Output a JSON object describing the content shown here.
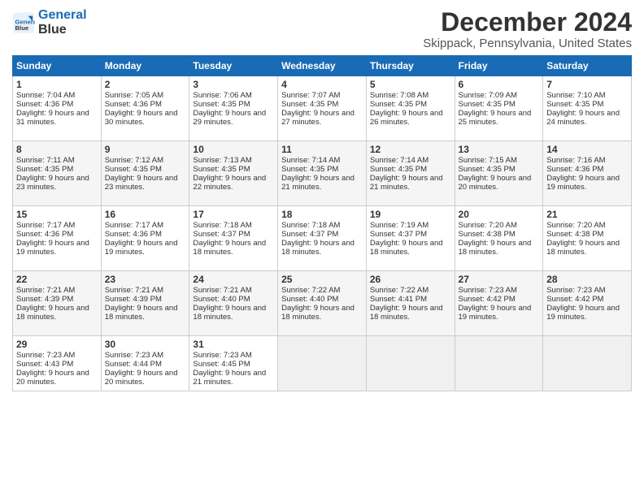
{
  "logo": {
    "line1": "General",
    "line2": "Blue"
  },
  "title": "December 2024",
  "subtitle": "Skippack, Pennsylvania, United States",
  "days": [
    "Sunday",
    "Monday",
    "Tuesday",
    "Wednesday",
    "Thursday",
    "Friday",
    "Saturday"
  ],
  "weeks": [
    [
      {
        "num": "1",
        "sunrise": "Sunrise: 7:04 AM",
        "sunset": "Sunset: 4:36 PM",
        "daylight": "Daylight: 9 hours and 31 minutes."
      },
      {
        "num": "2",
        "sunrise": "Sunrise: 7:05 AM",
        "sunset": "Sunset: 4:36 PM",
        "daylight": "Daylight: 9 hours and 30 minutes."
      },
      {
        "num": "3",
        "sunrise": "Sunrise: 7:06 AM",
        "sunset": "Sunset: 4:35 PM",
        "daylight": "Daylight: 9 hours and 29 minutes."
      },
      {
        "num": "4",
        "sunrise": "Sunrise: 7:07 AM",
        "sunset": "Sunset: 4:35 PM",
        "daylight": "Daylight: 9 hours and 27 minutes."
      },
      {
        "num": "5",
        "sunrise": "Sunrise: 7:08 AM",
        "sunset": "Sunset: 4:35 PM",
        "daylight": "Daylight: 9 hours and 26 minutes."
      },
      {
        "num": "6",
        "sunrise": "Sunrise: 7:09 AM",
        "sunset": "Sunset: 4:35 PM",
        "daylight": "Daylight: 9 hours and 25 minutes."
      },
      {
        "num": "7",
        "sunrise": "Sunrise: 7:10 AM",
        "sunset": "Sunset: 4:35 PM",
        "daylight": "Daylight: 9 hours and 24 minutes."
      }
    ],
    [
      {
        "num": "8",
        "sunrise": "Sunrise: 7:11 AM",
        "sunset": "Sunset: 4:35 PM",
        "daylight": "Daylight: 9 hours and 23 minutes."
      },
      {
        "num": "9",
        "sunrise": "Sunrise: 7:12 AM",
        "sunset": "Sunset: 4:35 PM",
        "daylight": "Daylight: 9 hours and 23 minutes."
      },
      {
        "num": "10",
        "sunrise": "Sunrise: 7:13 AM",
        "sunset": "Sunset: 4:35 PM",
        "daylight": "Daylight: 9 hours and 22 minutes."
      },
      {
        "num": "11",
        "sunrise": "Sunrise: 7:14 AM",
        "sunset": "Sunset: 4:35 PM",
        "daylight": "Daylight: 9 hours and 21 minutes."
      },
      {
        "num": "12",
        "sunrise": "Sunrise: 7:14 AM",
        "sunset": "Sunset: 4:35 PM",
        "daylight": "Daylight: 9 hours and 21 minutes."
      },
      {
        "num": "13",
        "sunrise": "Sunrise: 7:15 AM",
        "sunset": "Sunset: 4:35 PM",
        "daylight": "Daylight: 9 hours and 20 minutes."
      },
      {
        "num": "14",
        "sunrise": "Sunrise: 7:16 AM",
        "sunset": "Sunset: 4:36 PM",
        "daylight": "Daylight: 9 hours and 19 minutes."
      }
    ],
    [
      {
        "num": "15",
        "sunrise": "Sunrise: 7:17 AM",
        "sunset": "Sunset: 4:36 PM",
        "daylight": "Daylight: 9 hours and 19 minutes."
      },
      {
        "num": "16",
        "sunrise": "Sunrise: 7:17 AM",
        "sunset": "Sunset: 4:36 PM",
        "daylight": "Daylight: 9 hours and 19 minutes."
      },
      {
        "num": "17",
        "sunrise": "Sunrise: 7:18 AM",
        "sunset": "Sunset: 4:37 PM",
        "daylight": "Daylight: 9 hours and 18 minutes."
      },
      {
        "num": "18",
        "sunrise": "Sunrise: 7:18 AM",
        "sunset": "Sunset: 4:37 PM",
        "daylight": "Daylight: 9 hours and 18 minutes."
      },
      {
        "num": "19",
        "sunrise": "Sunrise: 7:19 AM",
        "sunset": "Sunset: 4:37 PM",
        "daylight": "Daylight: 9 hours and 18 minutes."
      },
      {
        "num": "20",
        "sunrise": "Sunrise: 7:20 AM",
        "sunset": "Sunset: 4:38 PM",
        "daylight": "Daylight: 9 hours and 18 minutes."
      },
      {
        "num": "21",
        "sunrise": "Sunrise: 7:20 AM",
        "sunset": "Sunset: 4:38 PM",
        "daylight": "Daylight: 9 hours and 18 minutes."
      }
    ],
    [
      {
        "num": "22",
        "sunrise": "Sunrise: 7:21 AM",
        "sunset": "Sunset: 4:39 PM",
        "daylight": "Daylight: 9 hours and 18 minutes."
      },
      {
        "num": "23",
        "sunrise": "Sunrise: 7:21 AM",
        "sunset": "Sunset: 4:39 PM",
        "daylight": "Daylight: 9 hours and 18 minutes."
      },
      {
        "num": "24",
        "sunrise": "Sunrise: 7:21 AM",
        "sunset": "Sunset: 4:40 PM",
        "daylight": "Daylight: 9 hours and 18 minutes."
      },
      {
        "num": "25",
        "sunrise": "Sunrise: 7:22 AM",
        "sunset": "Sunset: 4:40 PM",
        "daylight": "Daylight: 9 hours and 18 minutes."
      },
      {
        "num": "26",
        "sunrise": "Sunrise: 7:22 AM",
        "sunset": "Sunset: 4:41 PM",
        "daylight": "Daylight: 9 hours and 18 minutes."
      },
      {
        "num": "27",
        "sunrise": "Sunrise: 7:23 AM",
        "sunset": "Sunset: 4:42 PM",
        "daylight": "Daylight: 9 hours and 19 minutes."
      },
      {
        "num": "28",
        "sunrise": "Sunrise: 7:23 AM",
        "sunset": "Sunset: 4:42 PM",
        "daylight": "Daylight: 9 hours and 19 minutes."
      }
    ],
    [
      {
        "num": "29",
        "sunrise": "Sunrise: 7:23 AM",
        "sunset": "Sunset: 4:43 PM",
        "daylight": "Daylight: 9 hours and 20 minutes."
      },
      {
        "num": "30",
        "sunrise": "Sunrise: 7:23 AM",
        "sunset": "Sunset: 4:44 PM",
        "daylight": "Daylight: 9 hours and 20 minutes."
      },
      {
        "num": "31",
        "sunrise": "Sunrise: 7:23 AM",
        "sunset": "Sunset: 4:45 PM",
        "daylight": "Daylight: 9 hours and 21 minutes."
      },
      null,
      null,
      null,
      null
    ]
  ]
}
